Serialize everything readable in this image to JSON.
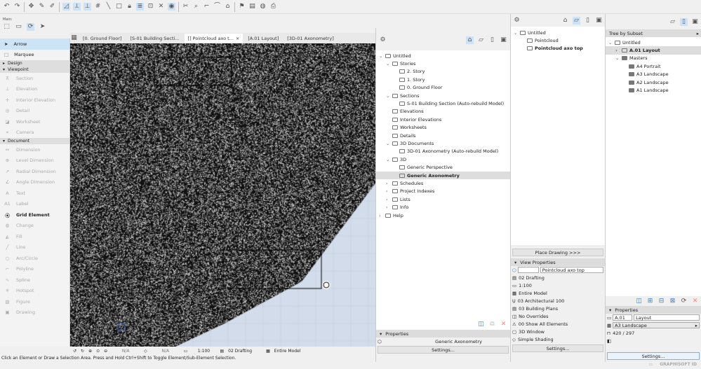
{
  "toolbar": {
    "main_label": "Main:"
  },
  "tabs": [
    {
      "label": "[0. Ground Floor]",
      "active": false
    },
    {
      "label": "[S-01 Building Secti...",
      "active": false
    },
    {
      "label": "[] Pointcloud axo t...",
      "active": true
    },
    {
      "label": "[A.01 Layout]",
      "active": false
    },
    {
      "label": "[3D-01 Axonometry]",
      "active": false
    }
  ],
  "toolbox": {
    "top": [
      {
        "label": "Arrow",
        "selected": true
      },
      {
        "label": "Marquee"
      }
    ],
    "groups": [
      {
        "label": "Design",
        "open": false,
        "items": []
      },
      {
        "label": "Viewpoint",
        "open": true,
        "items": [
          "Section",
          "Elevation",
          "Interior Elevation",
          "Detail",
          "Worksheet",
          "Camera"
        ]
      },
      {
        "label": "Document",
        "open": true,
        "items": [
          "Dimension",
          "Level Dimension",
          "Radial Dimension",
          "Angle Dimension",
          "Text",
          "Label",
          "Grid Element",
          "Change",
          "Fill",
          "Line",
          "Arc/Circle",
          "Polyline",
          "Spline",
          "Hotspot",
          "Figure",
          "Drawing"
        ]
      }
    ],
    "active_item": "Grid Element"
  },
  "viewbar": {
    "zoom1": "N/A",
    "zoom2": "N/A",
    "scale": "1:100",
    "layer": "02 Drafting",
    "model": "Entire Model"
  },
  "status": "Click an Element or Draw a Selection Area. Press and Hold Ctrl+Shift to Toggle Element/Sub-Element Selection.",
  "navigator": {
    "tree": [
      {
        "label": "Untitled",
        "level": 0,
        "arrow": "v"
      },
      {
        "label": "Stories",
        "level": 1,
        "arrow": "v"
      },
      {
        "label": "2. Story",
        "level": 2
      },
      {
        "label": "1. Story",
        "level": 2
      },
      {
        "label": "0. Ground Floor",
        "level": 2
      },
      {
        "label": "Sections",
        "level": 1,
        "arrow": "v"
      },
      {
        "label": "S-01 Building Section (Auto-rebuild Model)",
        "level": 2
      },
      {
        "label": "Elevations",
        "level": 1
      },
      {
        "label": "Interior Elevations",
        "level": 1
      },
      {
        "label": "Worksheets",
        "level": 1
      },
      {
        "label": "Details",
        "level": 1
      },
      {
        "label": "3D Documents",
        "level": 1,
        "arrow": "v"
      },
      {
        "label": "3D-01 Axonometry (Auto-rebuild Model)",
        "level": 2
      },
      {
        "label": "3D",
        "level": 1,
        "arrow": "v"
      },
      {
        "label": "Generic Perspective",
        "level": 2
      },
      {
        "label": "Generic Axonometry",
        "level": 2,
        "selected": true
      },
      {
        "label": "Schedules",
        "level": 1,
        "arrow": ">"
      },
      {
        "label": "Project Indexes",
        "level": 1,
        "arrow": ">"
      },
      {
        "label": "Lists",
        "level": 1,
        "arrow": ">"
      },
      {
        "label": "Info",
        "level": 1,
        "arrow": ">"
      },
      {
        "label": "Help",
        "level": 0,
        "arrow": ">"
      }
    ],
    "properties_label": "Properties",
    "properties_value": "Generic Axonometry",
    "settings": "Settings..."
  },
  "viewmap": {
    "tree": [
      {
        "label": "Untitled",
        "level": 0,
        "arrow": "v"
      },
      {
        "label": "Pointcloud",
        "level": 1
      },
      {
        "label": "Pointcloud axo top",
        "level": 1,
        "bold": true
      }
    ],
    "place_drawing": "Place Drawing >>>",
    "view_properties": "View Properties",
    "id_value": "",
    "name_value": "Pointcloud axo top",
    "rows": [
      "02 Drafting",
      "1:100",
      "Entire Model",
      "03 Architectural 100",
      "03 Building Plans",
      "No Overrides",
      "00 Show All Elements",
      "3D Window",
      "Simple Shading"
    ],
    "settings": "Settings..."
  },
  "layoutbook": {
    "tree_mode": "Tree by Subset",
    "tree": [
      {
        "label": "Untitled",
        "level": 0,
        "arrow": "v"
      },
      {
        "label": "A.01 Layout",
        "level": 1,
        "arrow": ">",
        "selected": true
      },
      {
        "label": "Masters",
        "level": 1,
        "arrow": "v"
      },
      {
        "label": "A4 Portrait",
        "level": 2
      },
      {
        "label": "A3 Landscape",
        "level": 2
      },
      {
        "label": "A2 Landscape",
        "level": 2
      },
      {
        "label": "A1 Landscape",
        "level": 2
      }
    ],
    "properties_label": "Properties",
    "id_value": "A.01",
    "name_value": "Layout",
    "master": "A3 Landscape",
    "size": "420 / 297",
    "settings": "Settings...",
    "brand": "GRAPHISOFT ID"
  },
  "colors": {
    "accent": "#cde3f6",
    "viewport_bg": "#d2dcea"
  }
}
